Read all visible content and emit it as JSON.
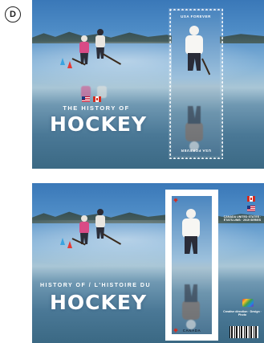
{
  "badge": "D",
  "sheet_top": {
    "stamp": {
      "denomination_top": "USA FOREVER",
      "denomination_bottom_reflected": "USA FOREVER"
    },
    "title_line1": "THE HISTORY OF",
    "title_line2": "HOCKEY"
  },
  "sheet_bottom": {
    "stamp": {
      "top_text": "CANADA",
      "bottom_text": "CANADA"
    },
    "title_line1": "HISTORY OF / L'HISTOIRE DU",
    "title_line2": "HOCKEY",
    "side_text_top": "CANADA UNITED STATES · ÉTATS-UNIS · 2019 SERIES",
    "side_text_bottom": "Creative direction · Design · Photo"
  },
  "colors": {
    "ice": "#a9c6d6",
    "sky": "#3a78b8",
    "maple_red": "#d52b1e"
  },
  "icons": [
    "us-flag-icon",
    "canada-flag-icon",
    "maple-leaf-icon",
    "barcode-icon"
  ]
}
